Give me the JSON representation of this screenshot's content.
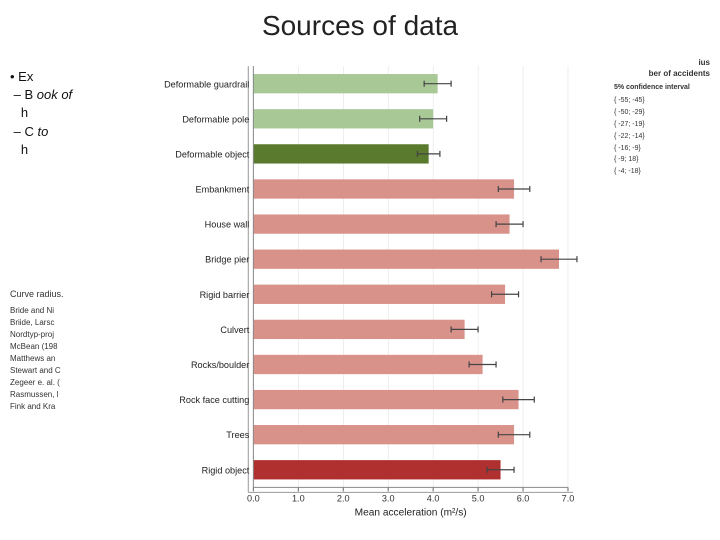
{
  "title": "Sources of data",
  "left_panel": {
    "bullet_prefix": "• Ex",
    "dash1": "– B",
    "dash1_suffix": "ook of",
    "dash1_mid": "h",
    "dash2": "– C",
    "dash2_suffix": "to",
    "dash2_mid": "h",
    "curve_radius_label": "Curve radius.",
    "references": [
      "Bride and Ni",
      "Briide, Larsc",
      "Nordtyp-proj",
      "McBean (198",
      "Matthews an",
      "Stewart and C",
      "Zegeer e. al. (",
      "Rasmussen, l",
      "Fink and Kra"
    ]
  },
  "chart": {
    "x_axis_label": "Mean acceleration (m²/s)",
    "x_ticks": [
      "0.0",
      "1.0",
      "2.0",
      "3.0",
      "4.0",
      "5.0",
      "6.0",
      "7.0"
    ],
    "bars": [
      {
        "label": "Deformable guardrail",
        "value": 4.1,
        "color": "#a8c896",
        "error": 0.3
      },
      {
        "label": "Deformable pole",
        "value": 4.0,
        "color": "#a8c896",
        "error": 0.3
      },
      {
        "label": "Deformable object",
        "value": 3.9,
        "color": "#5a7a2e",
        "error": 0.25
      },
      {
        "label": "Embankment",
        "value": 5.8,
        "color": "#d9928a",
        "error": 0.35
      },
      {
        "label": "House wall",
        "value": 5.7,
        "color": "#d9928a",
        "error": 0.3
      },
      {
        "label": "Bridge pier",
        "value": 6.8,
        "color": "#d9928a",
        "error": 0.4
      },
      {
        "label": "Rigid barrier",
        "value": 5.6,
        "color": "#d9928a",
        "error": 0.3
      },
      {
        "label": "Culvert",
        "value": 4.7,
        "color": "#d9928a",
        "error": 0.3
      },
      {
        "label": "Rocks/boulder",
        "value": 5.1,
        "color": "#d9928a",
        "error": 0.3
      },
      {
        "label": "Rock face cutting",
        "value": 5.9,
        "color": "#d9928a",
        "error": 0.35
      },
      {
        "label": "Trees",
        "value": 5.8,
        "color": "#d9928a",
        "error": 0.35
      },
      {
        "label": "Rigid object",
        "value": 5.5,
        "color": "#b03030",
        "error": 0.3
      }
    ]
  },
  "right_panel": {
    "radius_label": "ius",
    "accidents_label": "ber of accidents",
    "confidence_label": "5% confidence interval",
    "rows": [
      "{ -55; -45}",
      "{ -50; -29}",
      "{ -27; -19}",
      "{ -22; -14}",
      "{ -16; -9}",
      "{ -9; 18}",
      "{ -4; -18}"
    ]
  }
}
